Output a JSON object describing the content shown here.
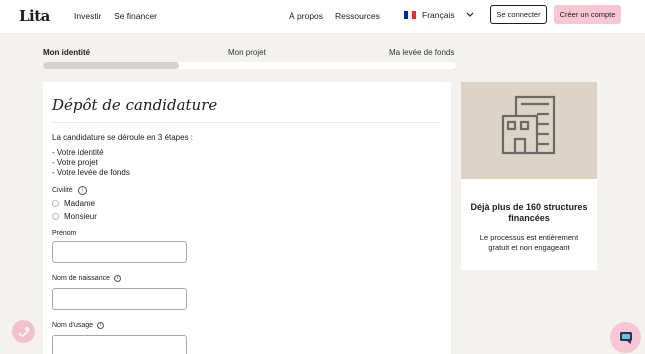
{
  "header": {
    "logo": "Lita",
    "nav_left": [
      "Investir",
      "Se financer"
    ],
    "nav_right": [
      "À propos",
      "Ressources"
    ],
    "language": "Français",
    "login_label": "Se connecter",
    "signup_label": "Créer un compte",
    "colors": {
      "signup_bg": "#f8c6d5",
      "flag": [
        "#002395",
        "#ffffff",
        "#ed2939"
      ]
    }
  },
  "stepper": {
    "steps": [
      "Mon identité",
      "Mon projet",
      "Ma levée de fonds"
    ],
    "active_index": 0,
    "progress_fraction": 0.33
  },
  "form": {
    "title": "Dépôt de candidature",
    "intro": "La candidature se déroule en 3 étapes :",
    "steps_list": [
      "- Votre identité",
      "- Votre projet",
      "- Votre levée de fonds"
    ],
    "civility_label": "Civilité",
    "civility_options": [
      "Madame",
      "Monsieur"
    ],
    "first_name_label": "Prénom",
    "first_name_value": "",
    "birth_name_label": "Nom de naissance",
    "birth_name_value": "",
    "usage_name_label": "Nom d'usage",
    "usage_name_value": ""
  },
  "sidebar": {
    "icon": "building-icon",
    "title": "Déjà plus de 160 structures financées",
    "text": "Le processus est entièrement gratuit et non engageant"
  },
  "floating": {
    "left_icon": "heart-hand-icon",
    "right_icon": "chat-icon"
  }
}
